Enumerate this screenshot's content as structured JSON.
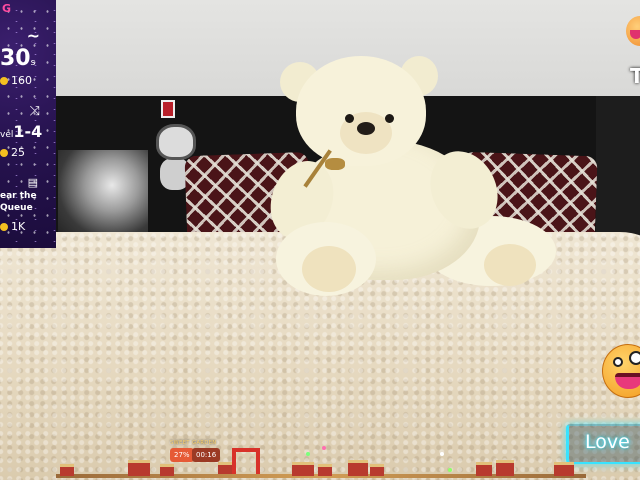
{
  "stream_overlay": {
    "top_label": "G",
    "tilde_icon": "~",
    "countdown_value": "30",
    "countdown_unit": "s",
    "tokens_1": "160",
    "shuffle_icon": "⤨",
    "level_prefix": "vel",
    "level_value": "1-4",
    "tokens_2": "25",
    "queue_icon": "▤",
    "queue_line1": "ear the",
    "queue_line2": "Queue",
    "tokens_3": "1K"
  },
  "right_widgets": {
    "letter": "T",
    "lovense_label": "Love"
  },
  "game_strip": {
    "title": "SWEET GARDEN",
    "percent": "27%",
    "timer": "00:16"
  },
  "colors": {
    "panel_bg": "#271350",
    "accent_pink": "#ff4aa0",
    "coin": "#f4c020",
    "lovense_glow": "#38e3ff"
  }
}
